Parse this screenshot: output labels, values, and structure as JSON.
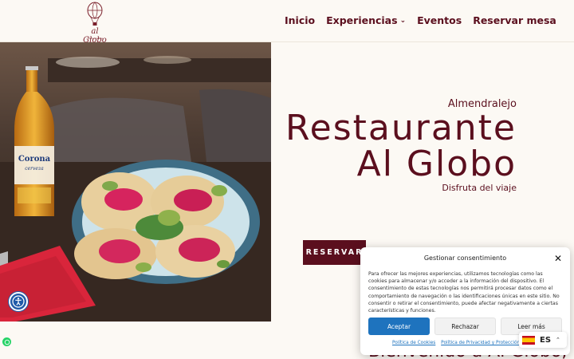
{
  "logo": {
    "name": "al Globo",
    "subtitle": "restaurante"
  },
  "nav": {
    "items": [
      {
        "label": "Inicio"
      },
      {
        "label": "Experiencias",
        "has_dropdown": true
      },
      {
        "label": "Eventos"
      },
      {
        "label": "Reservar mesa"
      }
    ]
  },
  "hero": {
    "town": "Almendralejo",
    "title_line1": "Restaurante",
    "title_line2": "Al Globo",
    "tagline": "Disfruta del viaje",
    "button_label": "RESERVAR",
    "image_bottle_label": "Corona",
    "image_bottle_sublabel": "cerveza"
  },
  "welcome": {
    "heading": "Bienvenido a Al Globo,"
  },
  "consent": {
    "title": "Gestionar consentimiento",
    "text": "Para ofrecer las mejores experiencias, utilizamos tecnologías como las cookies para almacenar y/o acceder a la información del dispositivo. El consentimiento de estas tecnologías nos permitirá procesar datos como el comportamiento de navegación o las identificaciones únicas en este sitio. No consentir o retirar el consentimiento, puede afectar negativamente a ciertas características y funciones.",
    "accept_label": "Aceptar",
    "reject_label": "Rechazar",
    "more_label": "Leer más",
    "link_cookies": "Política de Cookies",
    "link_privacy": "Política de Privacidad y Protección..."
  },
  "language": {
    "code": "ES"
  },
  "colors": {
    "brand": "#5b0f1e",
    "background": "#fcf9f4",
    "accept": "#1e73be"
  }
}
